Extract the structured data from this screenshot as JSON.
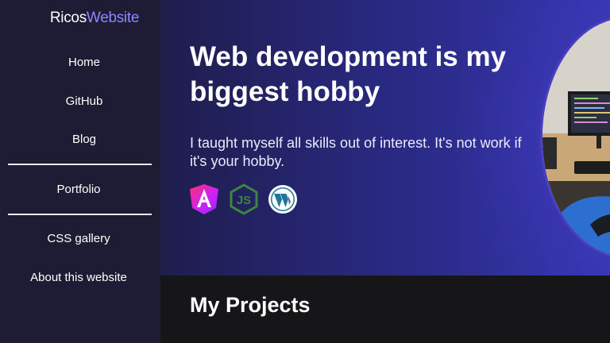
{
  "logo": {
    "part1": "Ricos",
    "part2": "Website"
  },
  "nav": {
    "home": "Home",
    "github": "GitHub",
    "blog": "Blog",
    "portfolio": "Portfolio",
    "css_gallery": "CSS gallery",
    "about": "About this website"
  },
  "hero": {
    "title": "Web development is my biggest hobby",
    "subtitle": "I taught myself all skills out of interest. It's not work if it's your hobby.",
    "tech_icons": [
      "angular-icon",
      "nodejs-icon",
      "wordpress-icon"
    ]
  },
  "projects": {
    "title": "My Projects"
  },
  "colors": {
    "sidebar_bg": "#1e1b35",
    "accent": "#8b87ff",
    "hero_bg": "#2a2a86",
    "projects_bg": "#161618"
  }
}
